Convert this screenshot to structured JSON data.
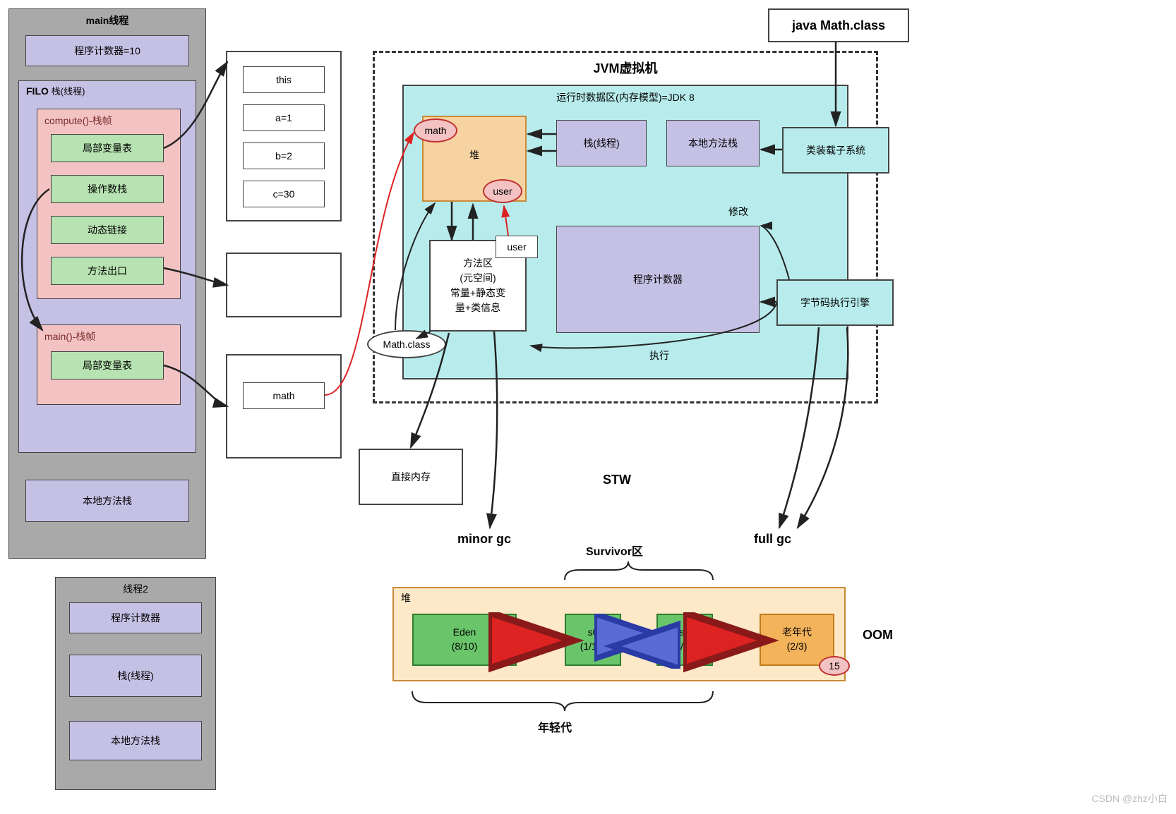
{
  "mainThread": {
    "title": "main线程",
    "programCounter": "程序计数器=10",
    "filo": {
      "title": "FILO",
      "subtitle": "栈(线程)",
      "computeFrame": {
        "title": "compute()-栈帧",
        "items": [
          "局部变量表",
          "操作数栈",
          "动态链接",
          "方法出口"
        ]
      },
      "mainFrame": {
        "title": "main()-栈帧",
        "item": "局部变量表"
      }
    },
    "nativeStack": "本地方法栈"
  },
  "thread2": {
    "title": "线程2",
    "items": [
      "程序计数器",
      "栈(线程)",
      "本地方法栈"
    ]
  },
  "frameDetail": {
    "items": [
      "this",
      "a=1",
      "b=2",
      "c=30"
    ]
  },
  "mathBox": "math",
  "jvm": {
    "title": "JVM虚拟机",
    "runtime": {
      "title": "运行时数据区(内存模型)=JDK 8",
      "heap": "堆",
      "mathTag": "math",
      "userTag": "user",
      "userLabel": "user",
      "stack": "栈(线程)",
      "nativeStack": "本地方法栈",
      "methodArea": "方法区\n(元空间)\n常量+静态变\n量+类信息",
      "pc": "程序计数器",
      "mathClass": "Math.class",
      "exec": "执行",
      "modify": "修改"
    },
    "classLoader": "类装载子系统",
    "execEngine": "字节码执行引擎",
    "javaMathClass": "java Math.class"
  },
  "directMemory": "直接内存",
  "gc": {
    "stw": "STW",
    "minor": "minor gc",
    "full": "full gc",
    "survivor": "Survivor区",
    "oom": "OOM",
    "young": "年轻代"
  },
  "heapDetail": {
    "title": "堆",
    "eden": {
      "name": "Eden",
      "ratio": "(8/10)"
    },
    "s0": {
      "name": "s0",
      "ratio": "(1/10)"
    },
    "s1": {
      "name": "s1",
      "ratio": "(1/10)"
    },
    "old": {
      "name": "老年代",
      "ratio": "(2/3)"
    },
    "badge": "15"
  },
  "watermark": "CSDN @zhz小白"
}
